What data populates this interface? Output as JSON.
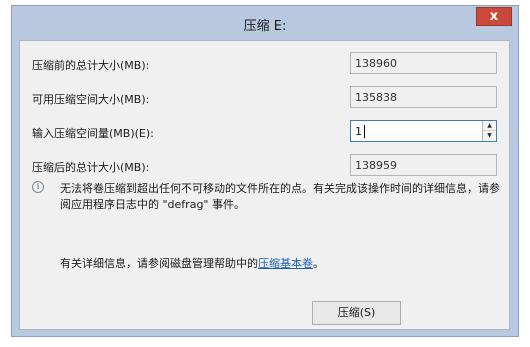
{
  "window": {
    "title": "压缩 E:",
    "close_glyph": "x"
  },
  "fields": [
    {
      "label": "压缩前的总计大小(MB):",
      "value": "138960"
    },
    {
      "label": "可用压缩空间大小(MB):",
      "value": "135838"
    },
    {
      "label": "输入压缩空间量(MB)(E):",
      "value": "1"
    },
    {
      "label": "压缩后的总计大小(MB):",
      "value": "138959"
    }
  ],
  "info": {
    "icon": "info-icon",
    "icon_glyph": "i",
    "text": "无法将卷压缩到超出任何不可移动的文件所在的点。有关完成该操作时间的详细信息，请参阅应用程序日志中的 \"defrag\" 事件。"
  },
  "help": {
    "prefix": "有关详细信息，请参阅磁盘管理帮助中的",
    "link": "压缩基本卷",
    "suffix": "。"
  },
  "buttons": {
    "shrink": "压缩(S)"
  },
  "colors": {
    "frame": "#b8c8df",
    "close": "#c94a3c",
    "client": "#f0f0f0",
    "link": "#1a5fb4",
    "focus_border": "#3c7fb1"
  }
}
